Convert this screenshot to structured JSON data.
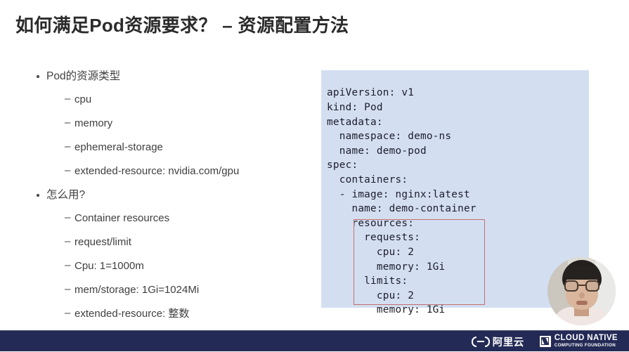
{
  "slide": {
    "title": "如何满足Pod资源要求？ – 资源配置方法",
    "background_color": "#ffffff"
  },
  "bullets": {
    "groups": [
      {
        "heading": "Pod的资源类型",
        "items": [
          "cpu",
          "memory",
          "ephemeral-storage",
          "extended-resource: nvidia.com/gpu"
        ]
      },
      {
        "heading": "怎么用?",
        "items": [
          "Container resources",
          "request/limit",
          "Cpu: 1=1000m",
          "mem/storage: 1Gi=1024Mi",
          "extended-resource: 整数"
        ]
      }
    ]
  },
  "code_block": {
    "language": "yaml",
    "background_color": "#d3dff1",
    "text": "apiVersion: v1\nkind: Pod\nmetadata:\n  namespace: demo-ns\n  name: demo-pod\nspec:\n  containers:\n  - image: nginx:latest\n    name: demo-container\n    resources:\n      requests:\n        cpu: 2\n        memory: 1Gi\n      limits:\n        cpu: 2\n        memory: 1Gi",
    "highlight": {
      "label": "resources-requests-limits-highlight",
      "color": "#c0706e"
    }
  },
  "webcam": {
    "label": "presenter-webcam"
  },
  "footer": {
    "background_color": "#232a55",
    "aliyun": {
      "name": "阿里云"
    },
    "cncf": {
      "line1": "CLOUD NATIVE",
      "line2": "COMPUTING FOUNDATION"
    }
  }
}
